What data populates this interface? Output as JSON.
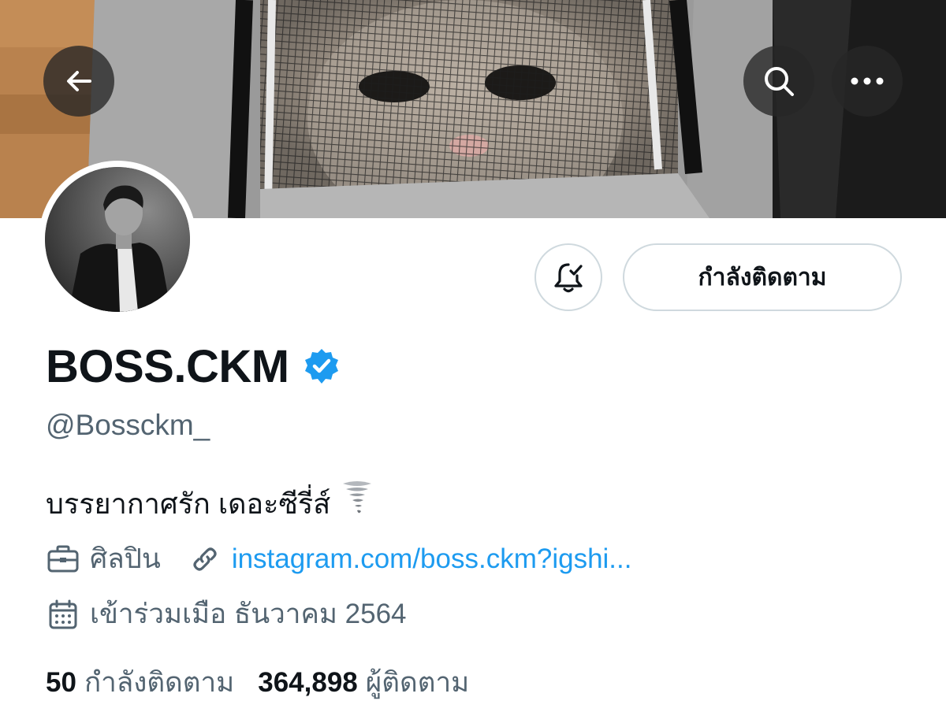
{
  "header": {
    "back_icon": "arrow-left-icon",
    "search_icon": "search-icon",
    "more_icon": "ellipsis-icon"
  },
  "actions": {
    "notify_icon": "bell-check-icon",
    "follow_label": "กำลังติดตาม"
  },
  "profile": {
    "display_name": "BOSS.CKM",
    "verified_icon": "verified-badge-icon",
    "handle": "@Bossckm_",
    "bio": "บรรยากาศรัก เดอะซีรี่ส์",
    "bio_emoji": "🌪",
    "category": "ศิลปิน",
    "link": "instagram.com/boss.ckm?igshi...",
    "joined": "เข้าร่วมเมือ ธันวาคม 2564"
  },
  "stats": {
    "following_count": "50",
    "following_label": "กำลังติดตาม",
    "followers_count": "364,898",
    "followers_label": "ผู้ติดตาม"
  },
  "colors": {
    "accent": "#1d9bf0",
    "secondary_text": "#536471",
    "primary_text": "#0f1419",
    "border": "#cfd9de"
  }
}
